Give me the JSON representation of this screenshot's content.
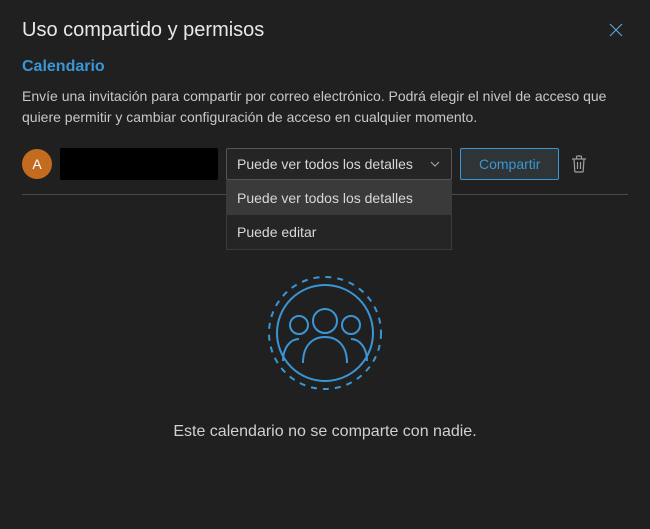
{
  "header": {
    "title": "Uso compartido y permisos"
  },
  "section": {
    "title": "Calendario",
    "description": "Envíe una invitación para compartir por correo electrónico. Podrá elegir el nivel de acceso que quiere permitir y cambiar configuración de acceso en cualquier momento."
  },
  "share": {
    "avatar_initial": "A",
    "dropdown_selected": "Puede ver todos los detalles",
    "dropdown_options": [
      "Puede ver todos los detalles",
      "Puede editar"
    ],
    "share_button": "Compartir"
  },
  "empty_state": {
    "text": "Este calendario no se comparte con nadie."
  },
  "colors": {
    "accent": "#3a96d6",
    "avatar_bg": "#c36b1e"
  }
}
